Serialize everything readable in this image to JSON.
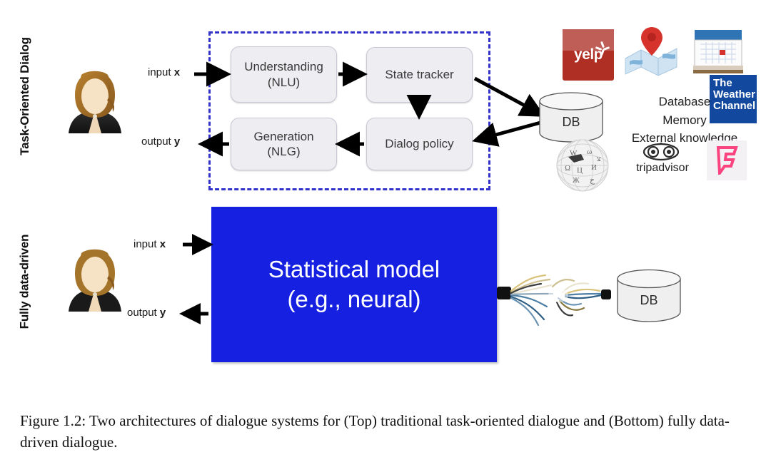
{
  "figure": {
    "caption": "Figure 1.2: Two architectures of dialogue systems for (Top) traditional task-oriented dialogue and (Bottom) fully data-driven dialogue."
  },
  "sections": {
    "top": {
      "side_label": "Task-Oriented Dialog",
      "io": {
        "input": "input ",
        "input_var": "x",
        "output": "output ",
        "output_var": "y"
      },
      "pipeline": [
        {
          "id": "nlu",
          "line1": "Understanding",
          "line2": "(NLU)"
        },
        {
          "id": "state-tracker",
          "line1": "State tracker",
          "line2": ""
        },
        {
          "id": "dialog-policy",
          "line1": "Dialog policy",
          "line2": ""
        },
        {
          "id": "nlg",
          "line1": "Generation",
          "line2": "(NLG)"
        }
      ],
      "database": {
        "label": "DB"
      },
      "knowledge_text": [
        "Database",
        "Memory",
        "External knowledge"
      ],
      "logos": [
        {
          "name": "yelp",
          "text": "yelp"
        },
        {
          "name": "maps",
          "text": ""
        },
        {
          "name": "calendar",
          "text": ""
        },
        {
          "name": "weather-channel",
          "line1": "The",
          "line2": "Weather",
          "line3": "Channel"
        },
        {
          "name": "wikipedia",
          "text": ""
        },
        {
          "name": "tripadvisor",
          "text": "tripadvisor"
        },
        {
          "name": "foursquare",
          "text": ""
        }
      ]
    },
    "bottom": {
      "side_label": "Fully data-driven",
      "io": {
        "input": "input ",
        "input_var": "x",
        "output": "output ",
        "output_var": "y"
      },
      "model_box": {
        "line1": "Statistical model",
        "line2": "(e.g., neural)"
      },
      "database": {
        "label": "DB"
      }
    }
  },
  "colors": {
    "model_blue": "#1520e0",
    "dashed_border": "#3333cc",
    "box_fill": "#eeeef2",
    "yelp_red": "#af2f24",
    "weather_blue": "#12499f",
    "foursquare_pink": "#f9447f"
  }
}
